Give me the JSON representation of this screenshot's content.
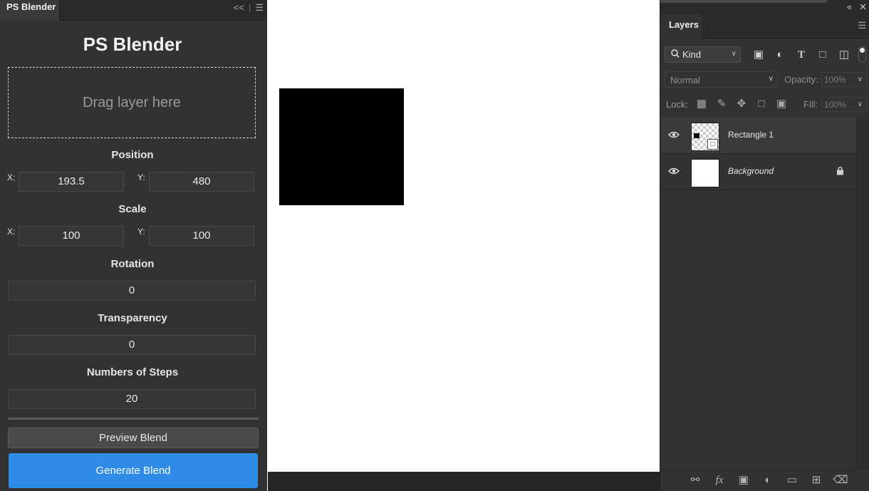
{
  "blender": {
    "tab_title": "PS Blender",
    "heading": "PS Blender",
    "drop_zone_label": "Drag layer here",
    "position": {
      "title": "Position",
      "x_label": "X:",
      "x_value": "193.5",
      "y_label": "Y:",
      "y_value": "480"
    },
    "scale": {
      "title": "Scale",
      "x_label": "X:",
      "x_value": "100",
      "y_label": "Y:",
      "y_value": "100"
    },
    "rotation": {
      "title": "Rotation",
      "value": "0"
    },
    "transparency": {
      "title": "Transparency",
      "value": "0"
    },
    "steps": {
      "title": "Numbers of Steps",
      "value": "20"
    },
    "preview_label": "Preview Blend",
    "generate_label": "Generate Blend",
    "accent_color": "#2e8ce6"
  },
  "layers_panel": {
    "tab_title": "Layers",
    "filter": {
      "kind_label": "Kind"
    },
    "blend_mode": "Normal",
    "opacity_label": "Opacity:",
    "opacity_value": "100%",
    "lock_label": "Lock:",
    "fill_label": "Fill:",
    "fill_value": "100%",
    "layers": [
      {
        "name": "Rectangle 1",
        "visible": true,
        "selected": true,
        "thumbnail": "transparent-with-black-rect",
        "locked": false
      },
      {
        "name": "Background",
        "visible": true,
        "selected": false,
        "thumbnail": "white",
        "locked": true
      }
    ],
    "filter_icons": [
      "image-filter-icon",
      "adjustment-filter-icon",
      "type-filter-icon",
      "shape-filter-icon",
      "smart-object-filter-icon"
    ],
    "lock_icons": [
      "lock-transparent-pixels-icon",
      "lock-image-pixels-icon",
      "lock-position-icon",
      "lock-artboard-icon",
      "lock-all-icon"
    ],
    "footer_icons": [
      "link-layers-icon",
      "fx-icon",
      "add-mask-icon",
      "adjustment-layer-icon",
      "group-folder-icon",
      "new-layer-icon",
      "delete-layer-icon"
    ]
  }
}
